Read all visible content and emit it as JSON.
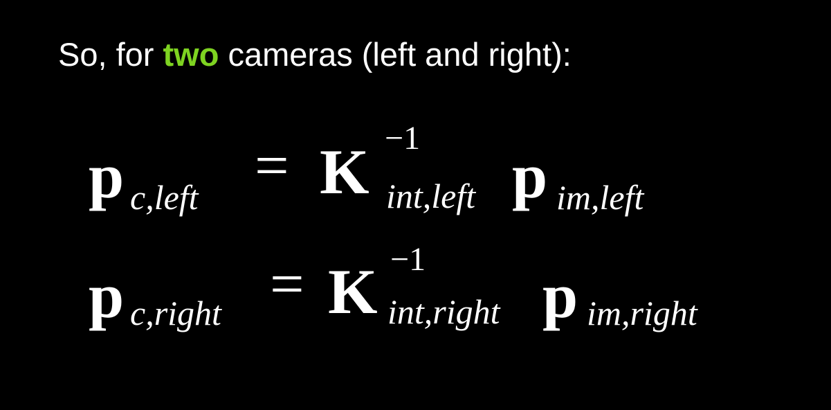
{
  "heading": {
    "prefix": "So, for ",
    "highlight": "two",
    "suffix": " cameras (left and right):",
    "highlight_color": "#7ed321"
  },
  "equations": [
    {
      "lhs_symbol": "p",
      "lhs_subscript": "c,left",
      "operator": "=",
      "matrix_symbol": "K",
      "matrix_superscript": "−1",
      "matrix_subscript": "int,left",
      "rhs_symbol": "p",
      "rhs_subscript": "im,left"
    },
    {
      "lhs_symbol": "p",
      "lhs_subscript": "c,right",
      "operator": "=",
      "matrix_symbol": "K",
      "matrix_superscript": "−1",
      "matrix_subscript": "int,right",
      "rhs_symbol": "p",
      "rhs_subscript": "im,right"
    }
  ]
}
